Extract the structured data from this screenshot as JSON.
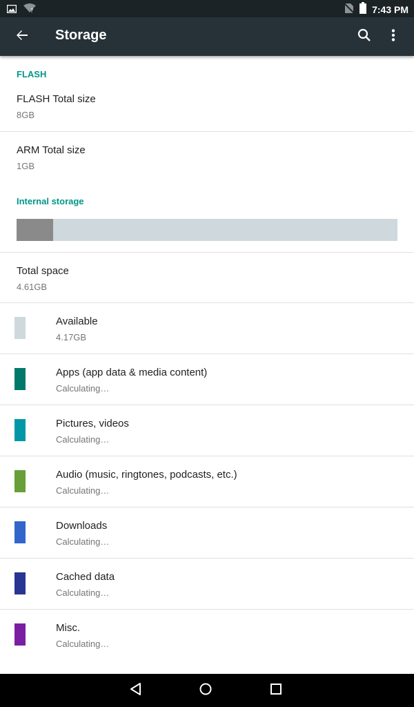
{
  "status_bar": {
    "time": "7:43 PM",
    "icons": [
      "image-icon",
      "wifi-icon",
      "no-sim-icon",
      "battery-icon"
    ]
  },
  "app_bar": {
    "title": "Storage",
    "actions": [
      "back-arrow-icon",
      "search-icon",
      "more-vert-icon"
    ]
  },
  "flash_section": {
    "header": "FLASH",
    "items": [
      {
        "title": "FLASH Total size",
        "summary": "8GB"
      },
      {
        "title": "ARM Total size",
        "summary": "1GB"
      }
    ]
  },
  "internal_section": {
    "header": "Internal storage",
    "usage": {
      "used_fraction": 0.096,
      "used_color": "#8a8a8a",
      "free_color": "#cfd8dc"
    },
    "total": {
      "title": "Total space",
      "summary": "4.61GB"
    },
    "categories": [
      {
        "title": "Available",
        "summary": "4.17GB",
        "color": "#cfd8dc"
      },
      {
        "title": "Apps (app data & media content)",
        "summary": "Calculating…",
        "color": "#00796b"
      },
      {
        "title": "Pictures, videos",
        "summary": "Calculating…",
        "color": "#0097a7"
      },
      {
        "title": "Audio (music, ringtones, podcasts, etc.)",
        "summary": "Calculating…",
        "color": "#689f38"
      },
      {
        "title": "Downloads",
        "summary": "Calculating…",
        "color": "#3366cc"
      },
      {
        "title": "Cached data",
        "summary": "Calculating…",
        "color": "#283593"
      },
      {
        "title": "Misc.",
        "summary": "Calculating…",
        "color": "#7b1fa2"
      }
    ]
  },
  "colors": {
    "accent": "#009688",
    "app_bar": "#263238",
    "status_bar": "#1c2327"
  },
  "nav_bar": {
    "buttons": [
      "back-triangle-icon",
      "home-circle-icon",
      "recents-square-icon"
    ]
  }
}
